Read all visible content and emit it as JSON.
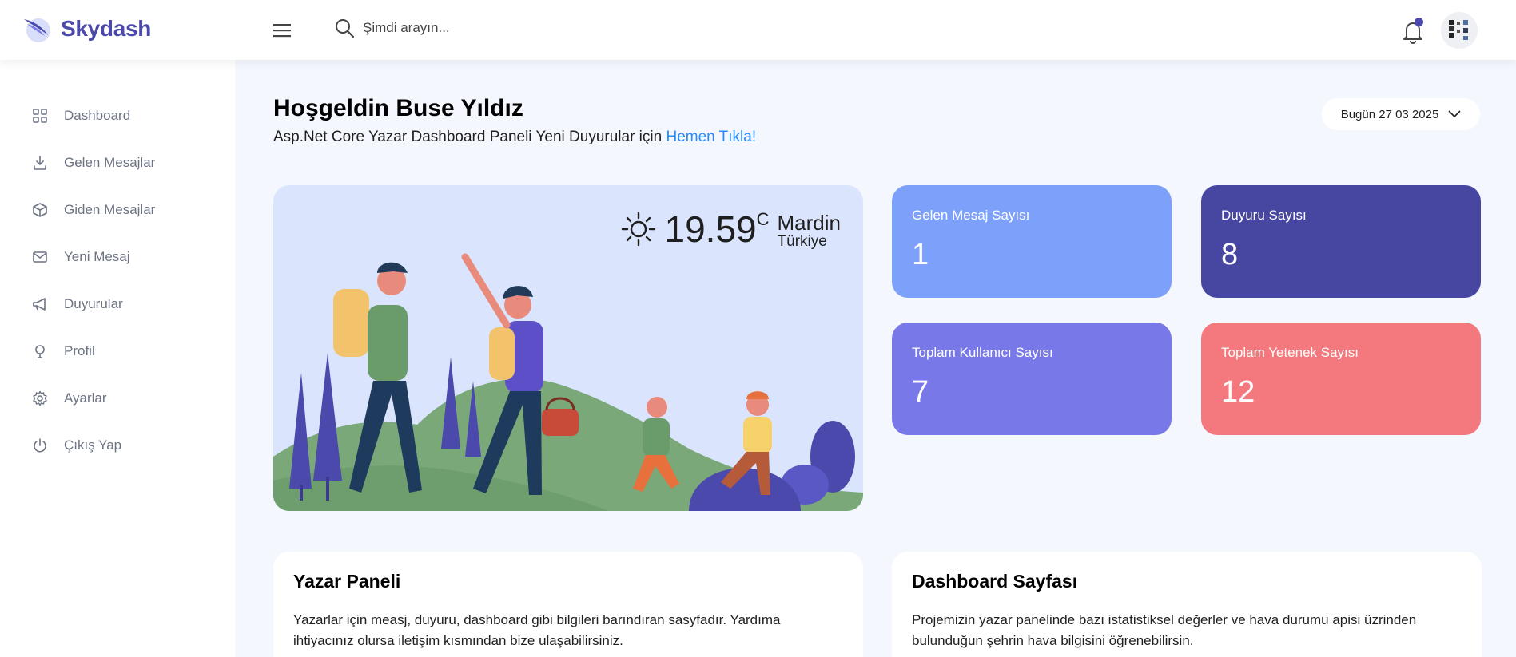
{
  "brand": {
    "name": "Skydash"
  },
  "search": {
    "placeholder": "Şimdi arayın..."
  },
  "sidebar": {
    "items": [
      {
        "label": "Dashboard",
        "icon": "grid-icon"
      },
      {
        "label": "Gelen Mesajlar",
        "icon": "download-icon"
      },
      {
        "label": "Giden Mesajlar",
        "icon": "box-icon"
      },
      {
        "label": "Yeni Mesaj",
        "icon": "mail-icon"
      },
      {
        "label": "Duyurular",
        "icon": "megaphone-icon"
      },
      {
        "label": "Profil",
        "icon": "user-icon"
      },
      {
        "label": "Ayarlar",
        "icon": "gear-icon"
      },
      {
        "label": "Çıkış Yap",
        "icon": "power-icon"
      }
    ]
  },
  "welcome": {
    "title": "Hoşgeldin Buse Yıldız",
    "subtitle": "Asp.Net Core Yazar Dashboard Paneli Yeni Duyurular için",
    "link": "Hemen Tıkla!"
  },
  "date_button": {
    "label": "Bugün 27 03 2025"
  },
  "weather": {
    "temperature": "19.59",
    "unit": "C",
    "city": "Mardin",
    "country": "Türkiye"
  },
  "stats": [
    {
      "title": "Gelen Mesaj Sayısı",
      "value": "1",
      "color": "#7da0fa"
    },
    {
      "title": "Duyuru Sayısı",
      "value": "8",
      "color": "#4747a1"
    },
    {
      "title": "Toplam Kullanıcı Sayısı",
      "value": "7",
      "color": "#7978e9"
    },
    {
      "title": "Toplam Yetenek Sayısı",
      "value": "12",
      "color": "#f3797e"
    }
  ],
  "info_cards": [
    {
      "title": "Yazar Paneli",
      "text": "Yazarlar için measj, duyuru, dashboard gibi bilgileri barındıran sasyfadır. Yardıma ihtiyacınız olursa iletişim kısmından bize ulaşabilirsiniz."
    },
    {
      "title": "Dashboard Sayfası",
      "text": "Projemizin yazar panelinde bazı istatistiksel değerler ve hava durumu apisi üzrinden bulunduğun şehrin hava bilgisini öğrenebilirsin."
    }
  ],
  "colors": {
    "accent": "#4b49ac",
    "link": "#248afd"
  }
}
